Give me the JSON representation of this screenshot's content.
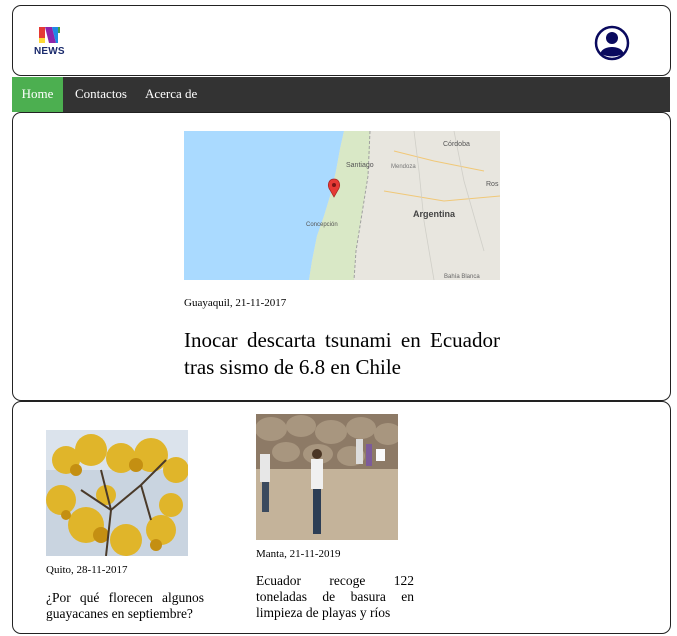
{
  "header": {
    "logo_text": "NEWS",
    "logo_icon": "news-logo-icon",
    "avatar_icon": "user-avatar-icon"
  },
  "nav": {
    "items": [
      {
        "label": "Home",
        "active": true
      },
      {
        "label": "Contactos",
        "active": false
      },
      {
        "label": "Acerca de",
        "active": false
      }
    ],
    "active_color": "#4CAF50",
    "background_color": "#333333"
  },
  "featured": {
    "map_labels": {
      "cordoba": "Córdoba",
      "santiago": "Santiago",
      "mendoza": "Mendoza",
      "rosario": "Ros",
      "argentina": "Argentina",
      "concepcion": "Concepción",
      "bahia_blanca": "Bahía Blanca"
    },
    "meta": "Guayaquil, 21-11-2017",
    "title": "Inocar descarta tsunami en Ecuador tras sismo de 6.8 en Chile"
  },
  "articles": [
    {
      "meta": "Quito, 28-11-2017",
      "title": "¿Por qué florecen algunos guayacanes en septiembre?"
    },
    {
      "meta": "Manta, 21-11-2019",
      "title": "Ecuador recoge 122 toneladas de basura en limpieza de playas y ríos"
    }
  ]
}
